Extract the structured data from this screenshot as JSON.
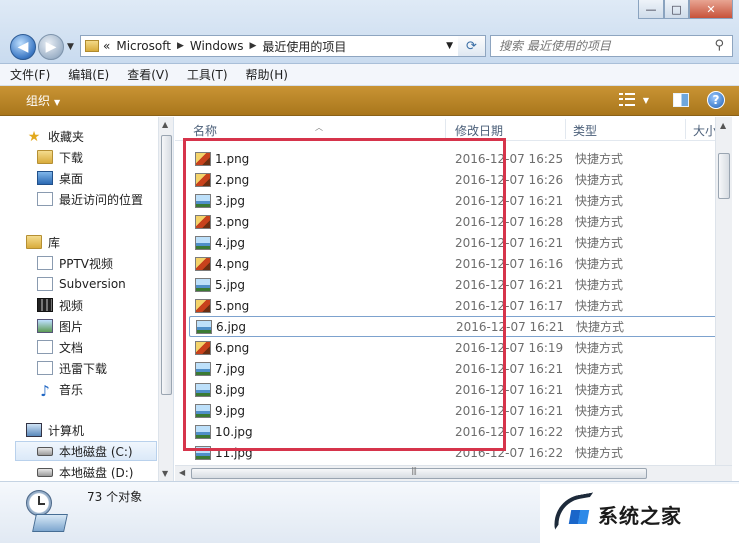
{
  "window": {
    "minimize": "—",
    "maximize": "□",
    "close": "✕"
  },
  "address": {
    "overflow": "«",
    "crumbs": [
      "Microsoft",
      "Windows",
      "最近使用的项目"
    ],
    "search_placeholder": "搜索 最近使用的项目"
  },
  "menu": [
    "文件(F)",
    "编辑(E)",
    "查看(V)",
    "工具(T)",
    "帮助(H)"
  ],
  "toolbar": {
    "organize": "组织",
    "help": "?"
  },
  "nav": {
    "favorites": "收藏夹",
    "downloads": "下载",
    "desktop": "桌面",
    "recent": "最近访问的位置",
    "libraries": "库",
    "pptv": "PPTV视频",
    "subversion": "Subversion",
    "videos": "视频",
    "pictures": "图片",
    "documents": "文档",
    "thunder": "迅雷下载",
    "music": "音乐",
    "computer": "计算机",
    "drive_c": "本地磁盘 (C:)",
    "drive_d": "本地磁盘 (D:)"
  },
  "columns": {
    "name": "名称",
    "date": "修改日期",
    "type": "类型",
    "size": "大小"
  },
  "files": [
    {
      "name": "1.png",
      "date": "2016-12-07 16:25",
      "type": "快捷方式",
      "icon": "png"
    },
    {
      "name": "2.png",
      "date": "2016-12-07 16:26",
      "type": "快捷方式",
      "icon": "png"
    },
    {
      "name": "3.jpg",
      "date": "2016-12-07 16:21",
      "type": "快捷方式",
      "icon": "jpg"
    },
    {
      "name": "3.png",
      "date": "2016-12-07 16:28",
      "type": "快捷方式",
      "icon": "png"
    },
    {
      "name": "4.jpg",
      "date": "2016-12-07 16:21",
      "type": "快捷方式",
      "icon": "jpg"
    },
    {
      "name": "4.png",
      "date": "2016-12-07 16:16",
      "type": "快捷方式",
      "icon": "png"
    },
    {
      "name": "5.jpg",
      "date": "2016-12-07 16:21",
      "type": "快捷方式",
      "icon": "jpg"
    },
    {
      "name": "5.png",
      "date": "2016-12-07 16:17",
      "type": "快捷方式",
      "icon": "png"
    },
    {
      "name": "6.jpg",
      "date": "2016-12-07 16:21",
      "type": "快捷方式",
      "icon": "jpg"
    },
    {
      "name": "6.png",
      "date": "2016-12-07 16:19",
      "type": "快捷方式",
      "icon": "png"
    },
    {
      "name": "7.jpg",
      "date": "2016-12-07 16:21",
      "type": "快捷方式",
      "icon": "jpg"
    },
    {
      "name": "8.jpg",
      "date": "2016-12-07 16:21",
      "type": "快捷方式",
      "icon": "jpg"
    },
    {
      "name": "9.jpg",
      "date": "2016-12-07 16:21",
      "type": "快捷方式",
      "icon": "jpg"
    },
    {
      "name": "10.jpg",
      "date": "2016-12-07 16:22",
      "type": "快捷方式",
      "icon": "jpg"
    },
    {
      "name": "11.jpg",
      "date": "2016-12-07 16:22",
      "type": "快捷方式",
      "icon": "jpg"
    }
  ],
  "status": {
    "count": "73 个对象"
  },
  "watermark": {
    "text": "系统之家"
  },
  "colors": {
    "command_bar": "#b5822a",
    "highlight": "#d6344b"
  }
}
